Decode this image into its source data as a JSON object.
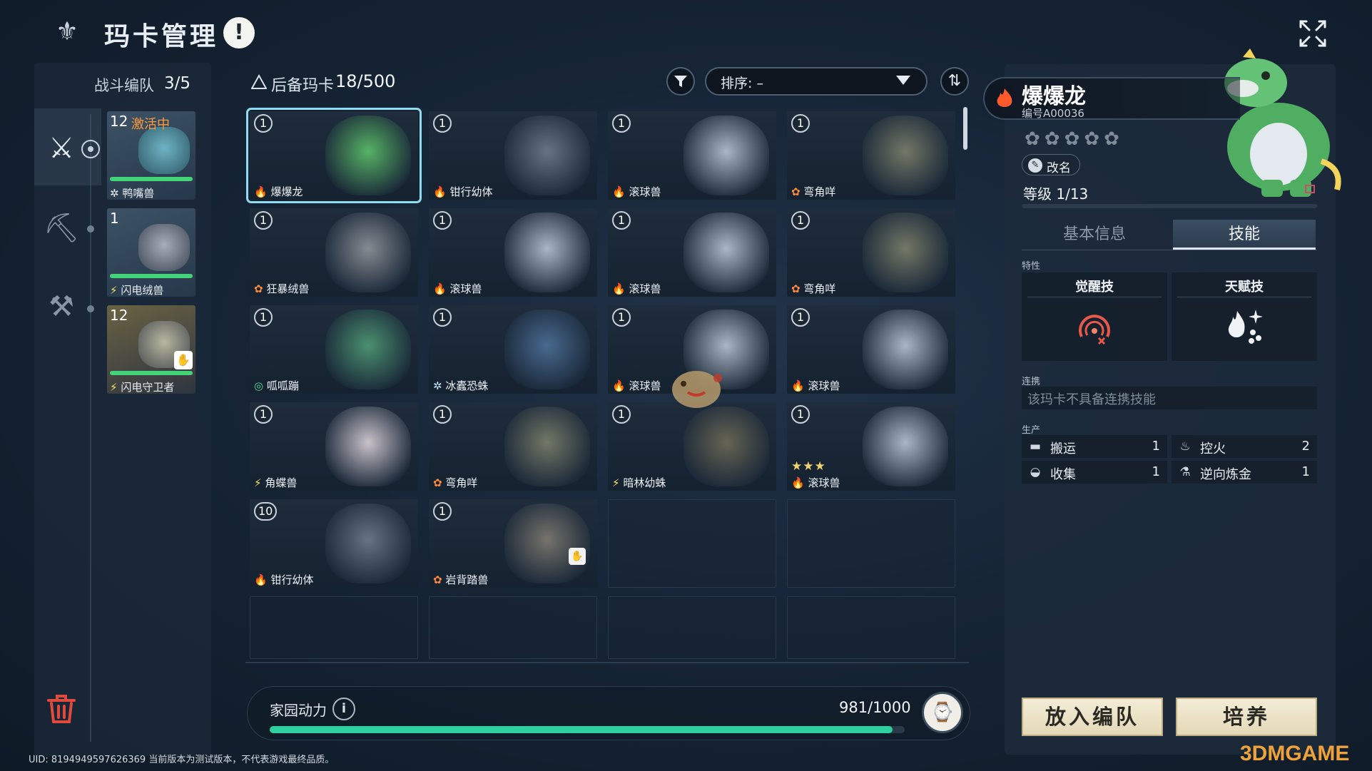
{
  "header": {
    "title": "玛卡管理",
    "alert_icon": "!"
  },
  "team": {
    "label": "战斗编队",
    "count": "3/5",
    "members": [
      {
        "level": "12",
        "status": "激活中",
        "name": "鸭嘴兽",
        "element": "ice",
        "element_glyph": "✲",
        "hp": 1.0,
        "art_color": "#4d8fa0"
      },
      {
        "level": "1",
        "status": "",
        "name": "闪电绒兽",
        "element": "electric",
        "element_glyph": "⚡",
        "hp": 1.0,
        "art_color": "#7d8793"
      },
      {
        "level": "12",
        "status": "",
        "name": "闪电守卫者",
        "element": "electric",
        "element_glyph": "⚡",
        "hp": 1.0,
        "art_color": "#8b8a7a"
      }
    ]
  },
  "reserve": {
    "title": "后备玛卡",
    "count": "18/500",
    "sort_label": "排序: –",
    "cards": [
      {
        "level": "1",
        "name": "爆爆龙",
        "element_glyph": "🔥",
        "element_color": "#ff6a3c",
        "art_color": "#5cbf6a",
        "selected": true
      },
      {
        "level": "1",
        "name": "钳行幼体",
        "element_glyph": "🔥",
        "element_color": "#ff6a3c",
        "art_color": "#6d7a8c"
      },
      {
        "level": "1",
        "name": "滚球兽",
        "element_glyph": "🔥",
        "element_color": "#ff6a3c",
        "art_color": "#b7c2d2"
      },
      {
        "level": "1",
        "name": "弯角咩",
        "element_glyph": "✿",
        "element_color": "#ff8a3c",
        "art_color": "#7a7e6a"
      },
      {
        "level": "1",
        "name": "狂暴绒兽",
        "element_glyph": "✿",
        "element_color": "#ff8a3c",
        "art_color": "#8f9399"
      },
      {
        "level": "1",
        "name": "滚球兽",
        "element_glyph": "🔥",
        "element_color": "#ff6a3c",
        "art_color": "#b7c2d2"
      },
      {
        "level": "1",
        "name": "滚球兽",
        "element_glyph": "🔥",
        "element_color": "#ff6a3c",
        "art_color": "#b7c2d2"
      },
      {
        "level": "1",
        "name": "弯角咩",
        "element_glyph": "✿",
        "element_color": "#ff8a3c",
        "art_color": "#7a7e6a"
      },
      {
        "level": "1",
        "name": "呱呱蹦",
        "element_glyph": "◎",
        "element_color": "#4fd39a",
        "art_color": "#4f9a74"
      },
      {
        "level": "1",
        "name": "冰蠹恐蛛",
        "element_glyph": "✲",
        "element_color": "#bde6ff",
        "art_color": "#4c6f96"
      },
      {
        "level": "1",
        "name": "滚球兽",
        "element_glyph": "🔥",
        "element_color": "#ff6a3c",
        "art_color": "#b7c2d2"
      },
      {
        "level": "1",
        "name": "滚球兽",
        "element_glyph": "🔥",
        "element_color": "#ff6a3c",
        "art_color": "#b7c2d2"
      },
      {
        "level": "1",
        "name": "角蝶兽",
        "element_glyph": "⚡",
        "element_color": "#f5e36a",
        "art_color": "#d8cfd6"
      },
      {
        "level": "1",
        "name": "弯角咩",
        "element_glyph": "✿",
        "element_color": "#ff8a3c",
        "art_color": "#7a7e6a"
      },
      {
        "level": "1",
        "name": "暗林幼蛛",
        "element_glyph": "⚡",
        "element_color": "#f5e36a",
        "art_color": "#6d6a56"
      },
      {
        "level": "1",
        "name": "滚球兽",
        "element_glyph": "🔥",
        "element_color": "#ff6a3c",
        "art_color": "#b7c2d2",
        "stars": "★★★"
      },
      {
        "level": "10",
        "name": "钳行幼体",
        "element_glyph": "🔥",
        "element_color": "#ff6a3c",
        "art_color": "#6d7a8c"
      },
      {
        "level": "1",
        "name": "岩背踏兽",
        "element_glyph": "✿",
        "element_color": "#ff8a3c",
        "art_color": "#7e7a70",
        "hand": true
      }
    ]
  },
  "power": {
    "label": "家园动力",
    "value": "981/1000",
    "fraction": 0.981
  },
  "detail": {
    "name": "爆爆龙",
    "id": "编号A00036",
    "stars": "✿✿✿✿✿",
    "rename": "改名",
    "level": "等级 1/13",
    "tabs": [
      "基本信息",
      "技能"
    ],
    "trait_label": "特性",
    "awaken_title": "觉醒技",
    "talent_title": "天赋技",
    "link_label": "连携",
    "link_text": "该玛卡不具备连携技能",
    "prod_label": "生产",
    "production": [
      {
        "icon": "carry-icon",
        "glyph": "▬",
        "label": "搬运",
        "value": "1"
      },
      {
        "icon": "fire-control-icon",
        "glyph": "♨",
        "label": "控火",
        "value": "2"
      },
      {
        "icon": "basket-icon",
        "glyph": "◒",
        "label": "收集",
        "value": "1"
      },
      {
        "icon": "alchemy-icon",
        "glyph": "⚗",
        "label": "逆向炼金",
        "value": "1"
      }
    ],
    "btn_team": "放入编队",
    "btn_train": "培养"
  },
  "footer": {
    "uid": "UID: 8194949597626369 当前版本为测试版本，不代表游戏最终品质。",
    "watermark": "3DMGAME"
  },
  "colors": {
    "accent": "#2fd0a0",
    "fire": "#ff6a3c",
    "active": "#ff9a3a"
  }
}
